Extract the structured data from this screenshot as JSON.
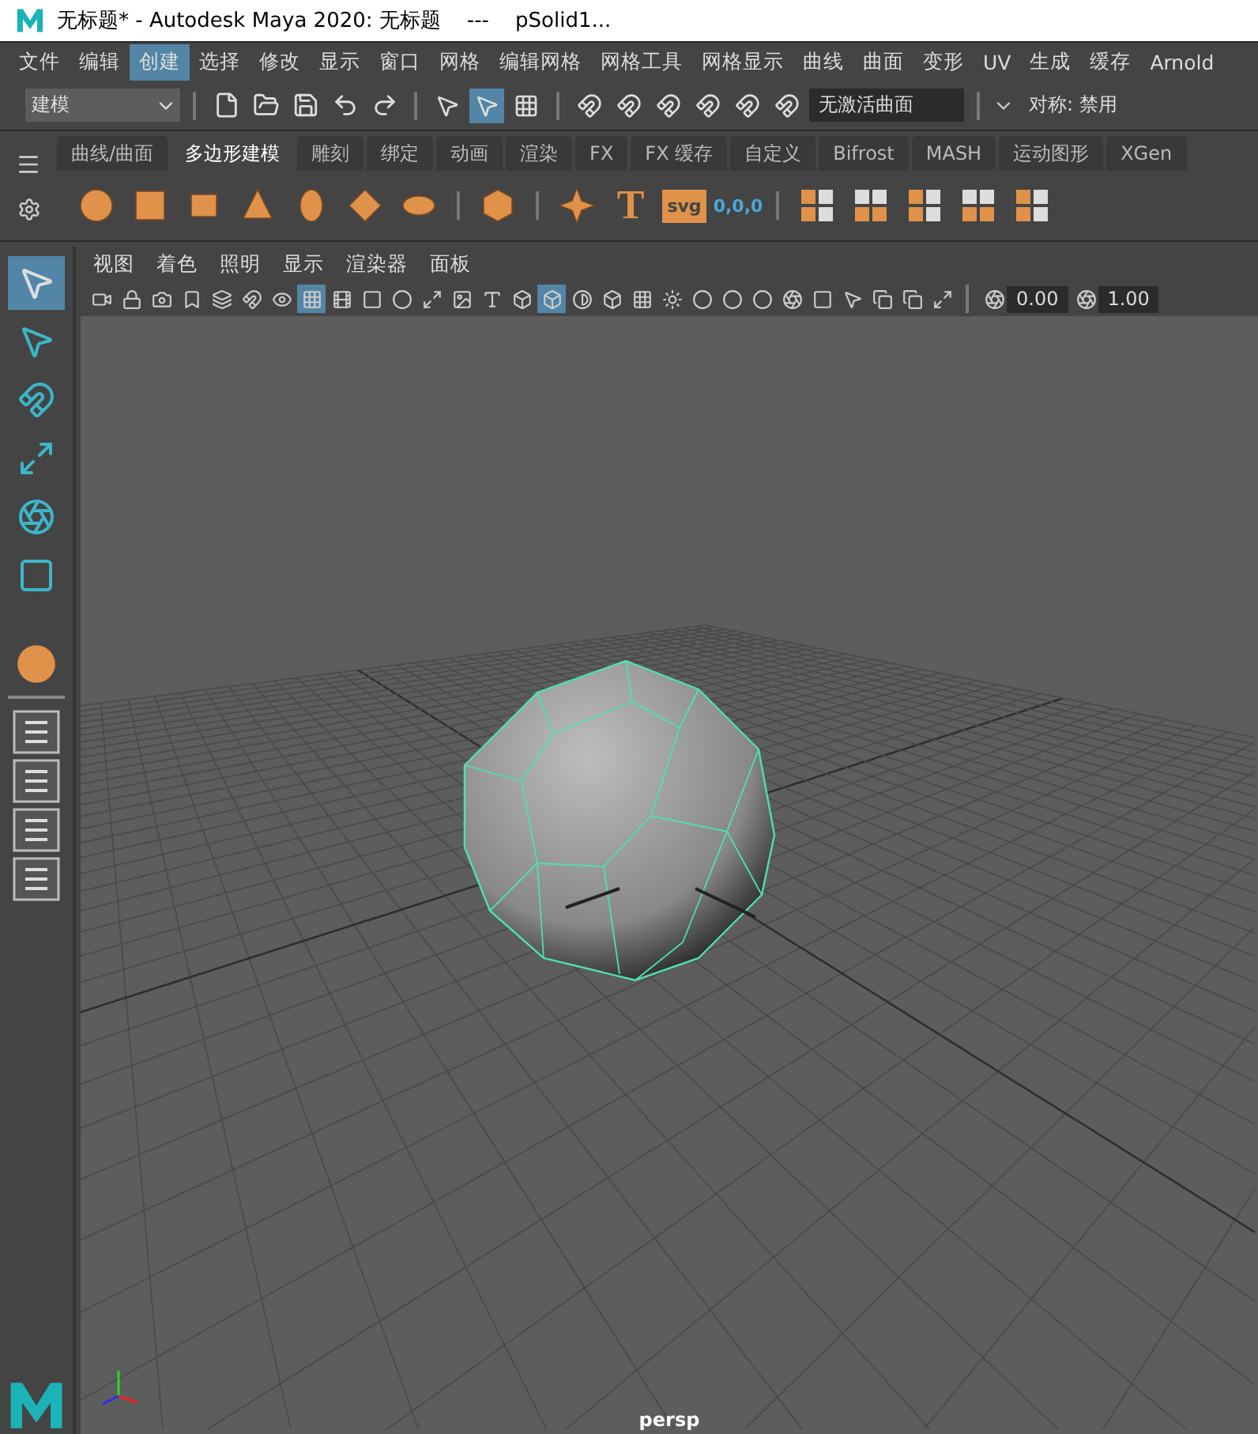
{
  "window": {
    "title": "无标题* - Autodesk Maya 2020: 无标题    ---    pSolid1..."
  },
  "menu_bar": [
    {
      "label": "文件",
      "selected": false
    },
    {
      "label": "编辑",
      "selected": false
    },
    {
      "label": "创建",
      "selected": true
    },
    {
      "label": "选择",
      "selected": false
    },
    {
      "label": "修改",
      "selected": false
    },
    {
      "label": "显示",
      "selected": false
    },
    {
      "label": "窗口",
      "selected": false
    },
    {
      "label": "网格",
      "selected": false
    },
    {
      "label": "编辑网格",
      "selected": false
    },
    {
      "label": "网格工具",
      "selected": false
    },
    {
      "label": "网格显示",
      "selected": false
    },
    {
      "label": "曲线",
      "selected": false
    },
    {
      "label": "曲面",
      "selected": false
    },
    {
      "label": "变形",
      "selected": false
    },
    {
      "label": "UV",
      "selected": false
    },
    {
      "label": "生成",
      "selected": false
    },
    {
      "label": "缓存",
      "selected": false
    },
    {
      "label": "Arnold",
      "selected": false
    }
  ],
  "status_line": {
    "menu_set": "建模",
    "selection_modes": [
      {
        "selected": false
      },
      {
        "selected": true
      },
      {
        "selected": false
      }
    ],
    "live_surface": "无激活曲面",
    "symmetry": "对称: 禁用"
  },
  "shelf": {
    "tabs": [
      {
        "label": "曲线/曲面",
        "selected": false
      },
      {
        "label": "多边形建模",
        "selected": true
      },
      {
        "label": "雕刻",
        "selected": false
      },
      {
        "label": "绑定",
        "selected": false
      },
      {
        "label": "动画",
        "selected": false
      },
      {
        "label": "渲染",
        "selected": false
      },
      {
        "label": "FX",
        "selected": false
      },
      {
        "label": "FX 缓存",
        "selected": false
      },
      {
        "label": "自定义",
        "selected": false
      },
      {
        "label": "Bifrost",
        "selected": false
      },
      {
        "label": "MASH",
        "selected": false
      },
      {
        "label": "运动图形",
        "selected": false
      },
      {
        "label": "XGen",
        "selected": false
      }
    ],
    "icon_labels": [
      "T",
      "svg",
      "0,0,0"
    ]
  },
  "tools": [
    {
      "selected": true
    },
    {
      "selected": false
    },
    {
      "selected": false
    },
    {
      "selected": false
    },
    {
      "selected": false
    },
    {
      "selected": false
    }
  ],
  "viewport": {
    "menu": [
      "视图",
      "着色",
      "照明",
      "显示",
      "渲染器",
      "面板"
    ],
    "toolbar_buttons": [
      {
        "selected": false
      },
      {
        "selected": false
      },
      {
        "selected": false
      },
      {
        "selected": false
      },
      {
        "selected": false
      },
      {
        "selected": false
      },
      {
        "selected": false
      },
      {
        "selected": true
      },
      {
        "selected": false
      },
      {
        "selected": false
      },
      {
        "selected": false
      },
      {
        "selected": false
      },
      {
        "selected": false
      },
      {
        "selected": false
      },
      {
        "selected": false
      },
      {
        "selected": true
      },
      {
        "selected": false
      },
      {
        "selected": false
      },
      {
        "selected": false
      },
      {
        "selected": false
      },
      {
        "selected": false
      },
      {
        "selected": false
      },
      {
        "selected": false
      },
      {
        "selected": false
      },
      {
        "selected": false
      },
      {
        "selected": false
      },
      {
        "selected": false
      },
      {
        "selected": false
      },
      {
        "selected": false
      }
    ],
    "fields": [
      "0.00",
      "1.00"
    ],
    "camera": "persp"
  }
}
